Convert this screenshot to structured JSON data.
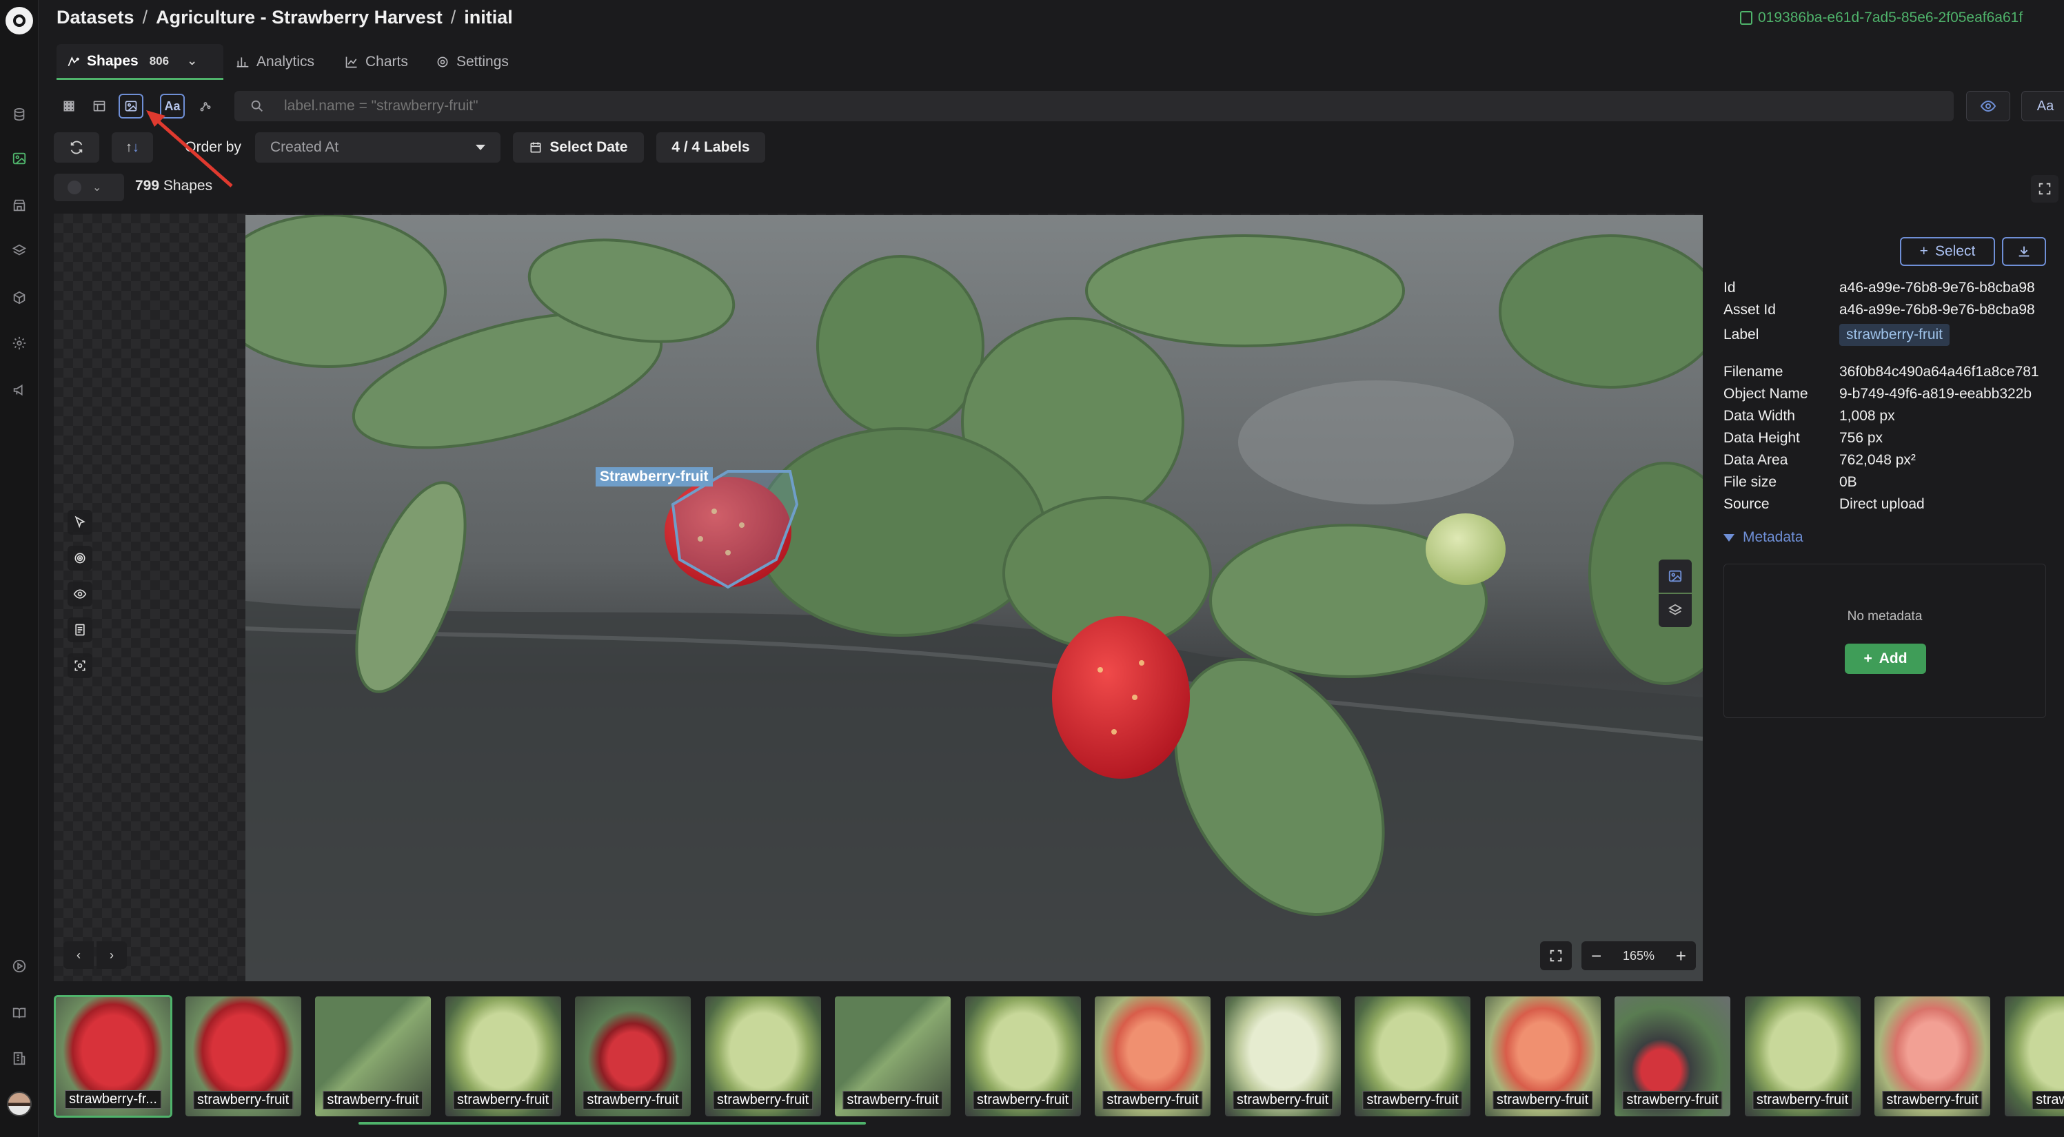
{
  "header": {
    "breadcrumb": [
      "Datasets",
      "Agriculture - Strawberry Harvest",
      "initial"
    ],
    "dataset_id": "019386ba-e61d-7ad5-85e6-2f05eaf6a61f"
  },
  "tabs": [
    {
      "label": "Shapes",
      "count": "806",
      "active": true,
      "icon": "shapes-icon"
    },
    {
      "label": "Analytics",
      "icon": "bar-chart-icon"
    },
    {
      "label": "Charts",
      "icon": "line-chart-icon"
    },
    {
      "label": "Settings",
      "icon": "gear-icon"
    }
  ],
  "toolbar": {
    "view_text_label": "Aa",
    "search": {
      "placeholder": "label.name = \"strawberry-fruit\"",
      "value": ""
    },
    "text_toggle_label": "Aa",
    "sort_up": "↑",
    "sort_down": "↓",
    "order_by_label": "Order by",
    "order_by_value": "Created At",
    "date_button": "Select Date",
    "labels_button": "4 / 4 Labels"
  },
  "results": {
    "count": "799",
    "unit": "Shapes"
  },
  "viewer": {
    "annotation_label": "Strawberry-fruit",
    "zoom_level": "165%",
    "zoom_out": "−",
    "zoom_in": "+",
    "prev": "‹",
    "next": "›"
  },
  "details": {
    "select_label": "Select",
    "fields": [
      {
        "key": "Id",
        "value": "a46-a99e-76b8-9e76-b8cba98"
      },
      {
        "key": "Asset Id",
        "value": "a46-a99e-76b8-9e76-b8cba98"
      },
      {
        "key": "Label",
        "value": "strawberry-fruit"
      },
      {
        "key": "Filename",
        "value": "36f0b84c490a64a46f1a8ce781"
      },
      {
        "key": "Object Name",
        "value": "9-b749-49f6-a819-eeabb322b"
      },
      {
        "key": "Data Width",
        "value": "1,008 px"
      },
      {
        "key": "Data Height",
        "value": "756 px"
      },
      {
        "key": "Data Area",
        "value": "762,048 px²"
      },
      {
        "key": "File size",
        "value": "0B"
      },
      {
        "key": "Source",
        "value": "Direct upload"
      }
    ],
    "metadata_title": "Metadata",
    "no_metadata": "No metadata",
    "add_label": "Add"
  },
  "thumbnails": [
    {
      "caption": "strawberry-fr...",
      "tone": "red",
      "selected": true
    },
    {
      "caption": "strawberry-fruit",
      "tone": "red"
    },
    {
      "caption": "strawberry-fruit",
      "tone": "leaf"
    },
    {
      "caption": "strawberry-fruit",
      "tone": "green"
    },
    {
      "caption": "strawberry-fruit",
      "tone": "red-leaf"
    },
    {
      "caption": "strawberry-fruit",
      "tone": "green"
    },
    {
      "caption": "strawberry-fruit",
      "tone": "leaf"
    },
    {
      "caption": "strawberry-fruit",
      "tone": "green"
    },
    {
      "caption": "strawberry-fruit",
      "tone": "orange"
    },
    {
      "caption": "strawberry-fruit",
      "tone": "pale"
    },
    {
      "caption": "strawberry-fruit",
      "tone": "green"
    },
    {
      "caption": "strawberry-fruit",
      "tone": "orange"
    },
    {
      "caption": "strawberry-fruit",
      "tone": "red-small"
    },
    {
      "caption": "strawberry-fruit",
      "tone": "green"
    },
    {
      "caption": "strawberry-fruit",
      "tone": "pink"
    },
    {
      "caption": "strawber",
      "tone": "green"
    }
  ],
  "colors": {
    "accent_green": "#4fb36b",
    "accent_blue": "#6f8fd6",
    "annotation": "#6f9ec9"
  }
}
